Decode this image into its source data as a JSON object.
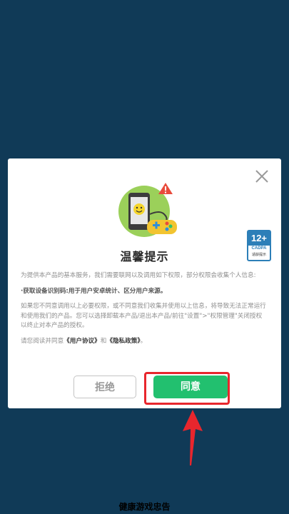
{
  "dialog": {
    "title": "温馨提示",
    "age_rating": {
      "number": "12+",
      "org": "CADPA",
      "note": "适龄提示"
    },
    "intro": "为提供本产品的基本服务，我们需要联网以及调用如下权限，部分权限会收集个人信息:",
    "permission": "·获取设备识别码:用于用户安卓统计、区分用户来源。",
    "refusal_notice": "如果您不同意调用以上必要权限，或不同意我们收集并使用以上信息，将导致无法正常运行和使用我们的产品。您可以选择卸载本产品/退出本产品/前往\"设置\">\"权限管理\"关闭授权以终止对本产品的授权。",
    "agreement_prefix": "请您阅读并同意",
    "user_agreement": "《用户协议》",
    "and": "和",
    "privacy_policy": "《隐私政策》",
    "agreement_suffix": "。",
    "reject_label": "拒绝",
    "agree_label": "同意"
  },
  "footer": {
    "text": "健康游戏忠告"
  },
  "colors": {
    "background": "#103a57",
    "agree_button": "#22c06f",
    "annotation": "#e8262d",
    "badge": "#2d7fb8"
  }
}
